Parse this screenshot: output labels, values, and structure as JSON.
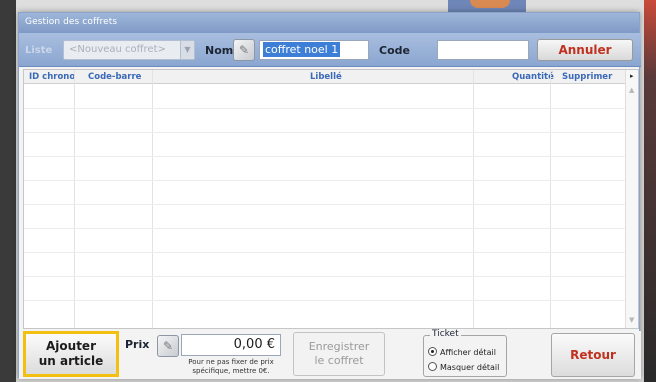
{
  "window": {
    "title": "Gestion des coffrets"
  },
  "toolbar": {
    "liste_label": "Liste",
    "select_value": "<Nouveau coffret>",
    "nom_label": "Nom",
    "nom_value": "coffret noel 1",
    "code_label": "Code",
    "code_value": "",
    "cancel_label": "Annuler"
  },
  "grid": {
    "columns": [
      "ID chrono",
      "Code-barre",
      "Libellé",
      "Quantité",
      "Supprimer"
    ]
  },
  "bottom": {
    "add_line1": "Ajouter",
    "add_line2": "un article",
    "prix_label": "Prix",
    "prix_value": "0,00 €",
    "prix_hint_line1": "Pour ne pas fixer de prix",
    "prix_hint_line2": "spécifique, mettre 0€.",
    "save_line1": "Enregistrer",
    "save_line2": "le coffret",
    "ticket_legend": "Ticket",
    "ticket_option1": "Afficher détail",
    "ticket_option2": "Masquer détail",
    "retour_label": "Retour"
  },
  "colors": {
    "accent_blue": "#8aa6d0",
    "highlight_yellow": "#f3c011",
    "action_red": "#c0321f"
  }
}
